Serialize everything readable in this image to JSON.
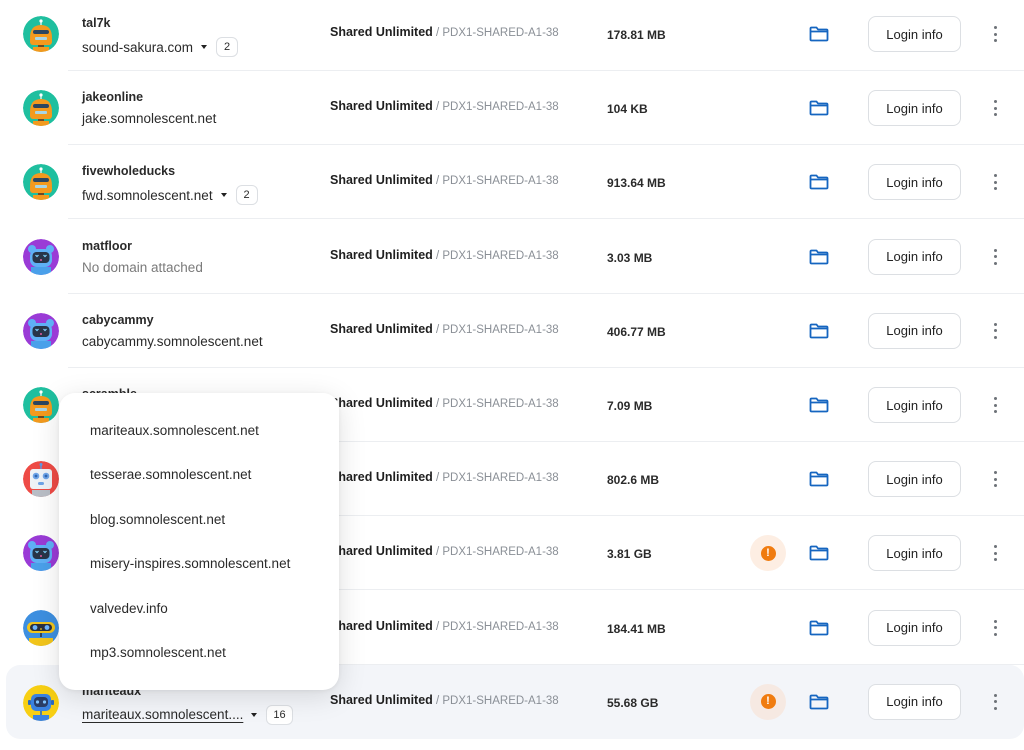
{
  "colors": {
    "accent_blue": "#1565c0",
    "warning_orange": "#f07c10",
    "hover_row_bg": "#f3f5f9"
  },
  "common": {
    "login_label": "Login info",
    "folder_icon": "folder-icon",
    "more_icon": "more-vertical-icon",
    "warning_icon": "warning-icon"
  },
  "rows": [
    {
      "username": "tal7k",
      "domain": "sound-sakura.com",
      "has_dropdown": true,
      "domain_count": "2",
      "plan": "Shared Unlimited",
      "server": " / PDX1-SHARED-A1-38",
      "size": "178.81 MB",
      "warning": false,
      "avatar": "orange-robot"
    },
    {
      "username": "jakeonline",
      "domain": "jake.somnolescent.net",
      "has_dropdown": false,
      "plan": "Shared Unlimited",
      "server": " / PDX1-SHARED-A1-38",
      "size": "104 KB",
      "warning": false,
      "avatar": "orange-robot"
    },
    {
      "username": "fivewholeducks",
      "domain": "fwd.somnolescent.net",
      "has_dropdown": true,
      "domain_count": "2",
      "plan": "Shared Unlimited",
      "server": " / PDX1-SHARED-A1-38",
      "size": "913.64 MB",
      "warning": false,
      "avatar": "orange-robot"
    },
    {
      "username": "matfloor",
      "domain": "No domain attached",
      "no_domain": true,
      "has_dropdown": false,
      "plan": "Shared Unlimited",
      "server": " / PDX1-SHARED-A1-38",
      "size": "3.03 MB",
      "warning": false,
      "avatar": "purple-robot"
    },
    {
      "username": "cabycammy",
      "domain": "cabycammy.somnolescent.net",
      "has_dropdown": false,
      "plan": "Shared Unlimited",
      "server": " / PDX1-SHARED-A1-38",
      "size": "406.77 MB",
      "warning": false,
      "avatar": "purple-robot"
    },
    {
      "username": "scramble",
      "domain": "",
      "has_dropdown": false,
      "plan": "Shared Unlimited",
      "server": " / PDX1-SHARED-A1-38",
      "size": "7.09 MB",
      "warning": false,
      "avatar": "orange-robot"
    },
    {
      "username": "",
      "domain": "",
      "has_dropdown": false,
      "plan": "Shared Unlimited",
      "server": " / PDX1-SHARED-A1-38",
      "size": "802.6 MB",
      "warning": false,
      "avatar": "red-robot"
    },
    {
      "username": "",
      "domain": "",
      "has_dropdown": false,
      "plan": "Shared Unlimited",
      "server": " / PDX1-SHARED-A1-38",
      "size": "3.81 GB",
      "warning": true,
      "avatar": "purple-robot"
    },
    {
      "username": "",
      "domain": "",
      "has_dropdown": false,
      "plan": "Shared Unlimited",
      "server": " / PDX1-SHARED-A1-38",
      "size": "184.41 MB",
      "warning": false,
      "avatar": "blue-yellow-robot"
    },
    {
      "username": "mariteaux",
      "domain": "mariteaux.somnolescent....",
      "has_dropdown": true,
      "domain_count": "16",
      "plan": "Shared Unlimited",
      "server": " / PDX1-SHARED-A1-38",
      "size": "55.68 GB",
      "warning": true,
      "avatar": "yellow-blue-robot",
      "hovered": true
    }
  ],
  "domain_dropdown": {
    "options": [
      "mariteaux.somnolescent.net",
      "tesserae.somnolescent.net",
      "blog.somnolescent.net",
      "misery-inspires.somnolescent.net",
      "valvedev.info",
      "mp3.somnolescent.net"
    ]
  }
}
